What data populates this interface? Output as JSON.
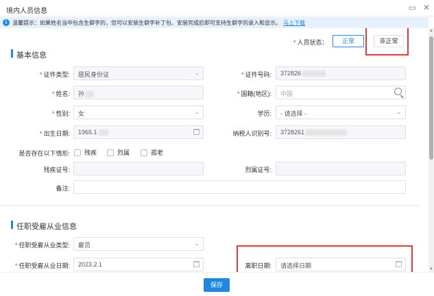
{
  "window": {
    "title": "境内人员信息",
    "btn_restore": "▭",
    "btn_close": "✕"
  },
  "tip": {
    "text": "温馨提示：如果姓名当中包含生僻字的，您可以安装生僻字补丁包，安装完成后即可支持生僻字的录入和显示。",
    "link": "马上下载"
  },
  "status": {
    "label": "人员状态：",
    "normal": "正常",
    "abnormal": "非正常"
  },
  "basic": {
    "title": "基本信息",
    "id_type_label": "证件类型:",
    "id_type_value": "居民身份证",
    "id_no_label": "证件号码:",
    "id_no_value": "372826",
    "name_label": "姓名:",
    "name_value": "孙",
    "country_label": "国籍(地区):",
    "country_placeholder": "中国",
    "gender_label": "性别:",
    "gender_value": "女",
    "edu_label": "学历:",
    "edu_value": "- 请选择 -",
    "birth_label": "出生日期:",
    "birth_value": "1965.1",
    "tax_id_label": "纳税人识别号:",
    "tax_id_value": "3728261",
    "exists_label": "是否存在以下情形:",
    "opt_disabled": "残疾",
    "opt_martyr": "烈属",
    "opt_elderly": "孤老",
    "disabled_no_label": "残疾证号:",
    "martyr_no_label": "烈属证号:",
    "remark_label": "备注:"
  },
  "employment": {
    "title": "任职受雇从业信息",
    "type_label": "任职受雇从业类型:",
    "type_value": "雇员",
    "date_label": "任职受雇从业日期:",
    "date_value": "2023.2.1",
    "leave_label": "离职日期:",
    "leave_placeholder": "请选择日期"
  },
  "footer": {
    "save": "保存"
  }
}
